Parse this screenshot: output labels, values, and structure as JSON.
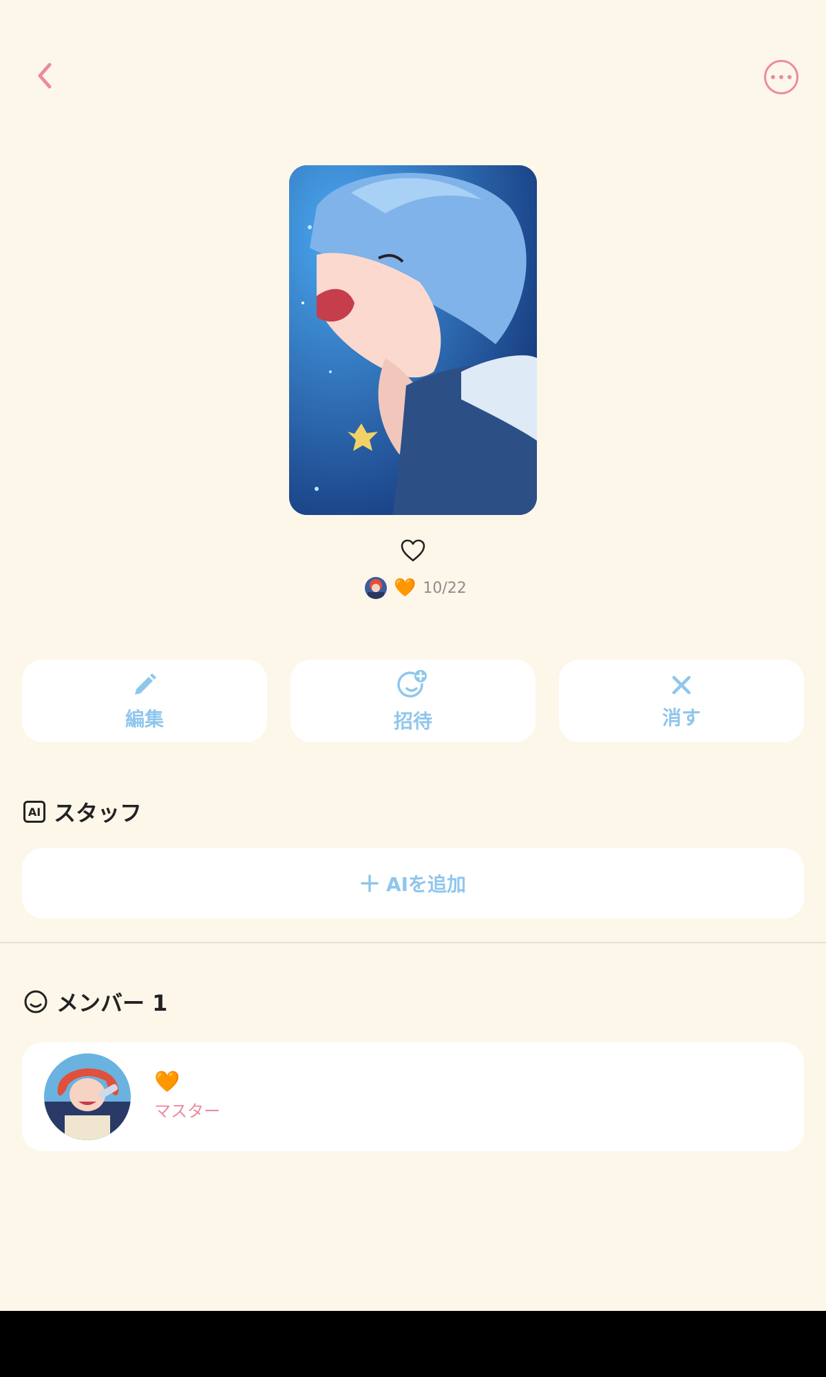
{
  "colors": {
    "background": "#fdf7ea",
    "accent_pink": "#ec8aa0",
    "accent_blue": "#8fc6ec",
    "heart_orange": "#ff9f1a"
  },
  "header": {
    "back_icon": "chevron-left-icon",
    "more_icon": "more-horizontal-icon"
  },
  "cover": {
    "favorite_icon": "heart-outline-icon"
  },
  "meta": {
    "heart_emoji": "🧡",
    "date": "10/22"
  },
  "actions": [
    {
      "icon": "pencil-icon",
      "label": "編集"
    },
    {
      "icon": "invite-icon",
      "label": "招待"
    },
    {
      "icon": "close-icon",
      "label": "消す"
    }
  ],
  "staff": {
    "badge": "AI",
    "title": "スタッフ",
    "add_label": "AIを追加"
  },
  "members": {
    "title": "メンバー 1",
    "list": [
      {
        "emoji": "🧡",
        "role": "マスター"
      }
    ]
  }
}
